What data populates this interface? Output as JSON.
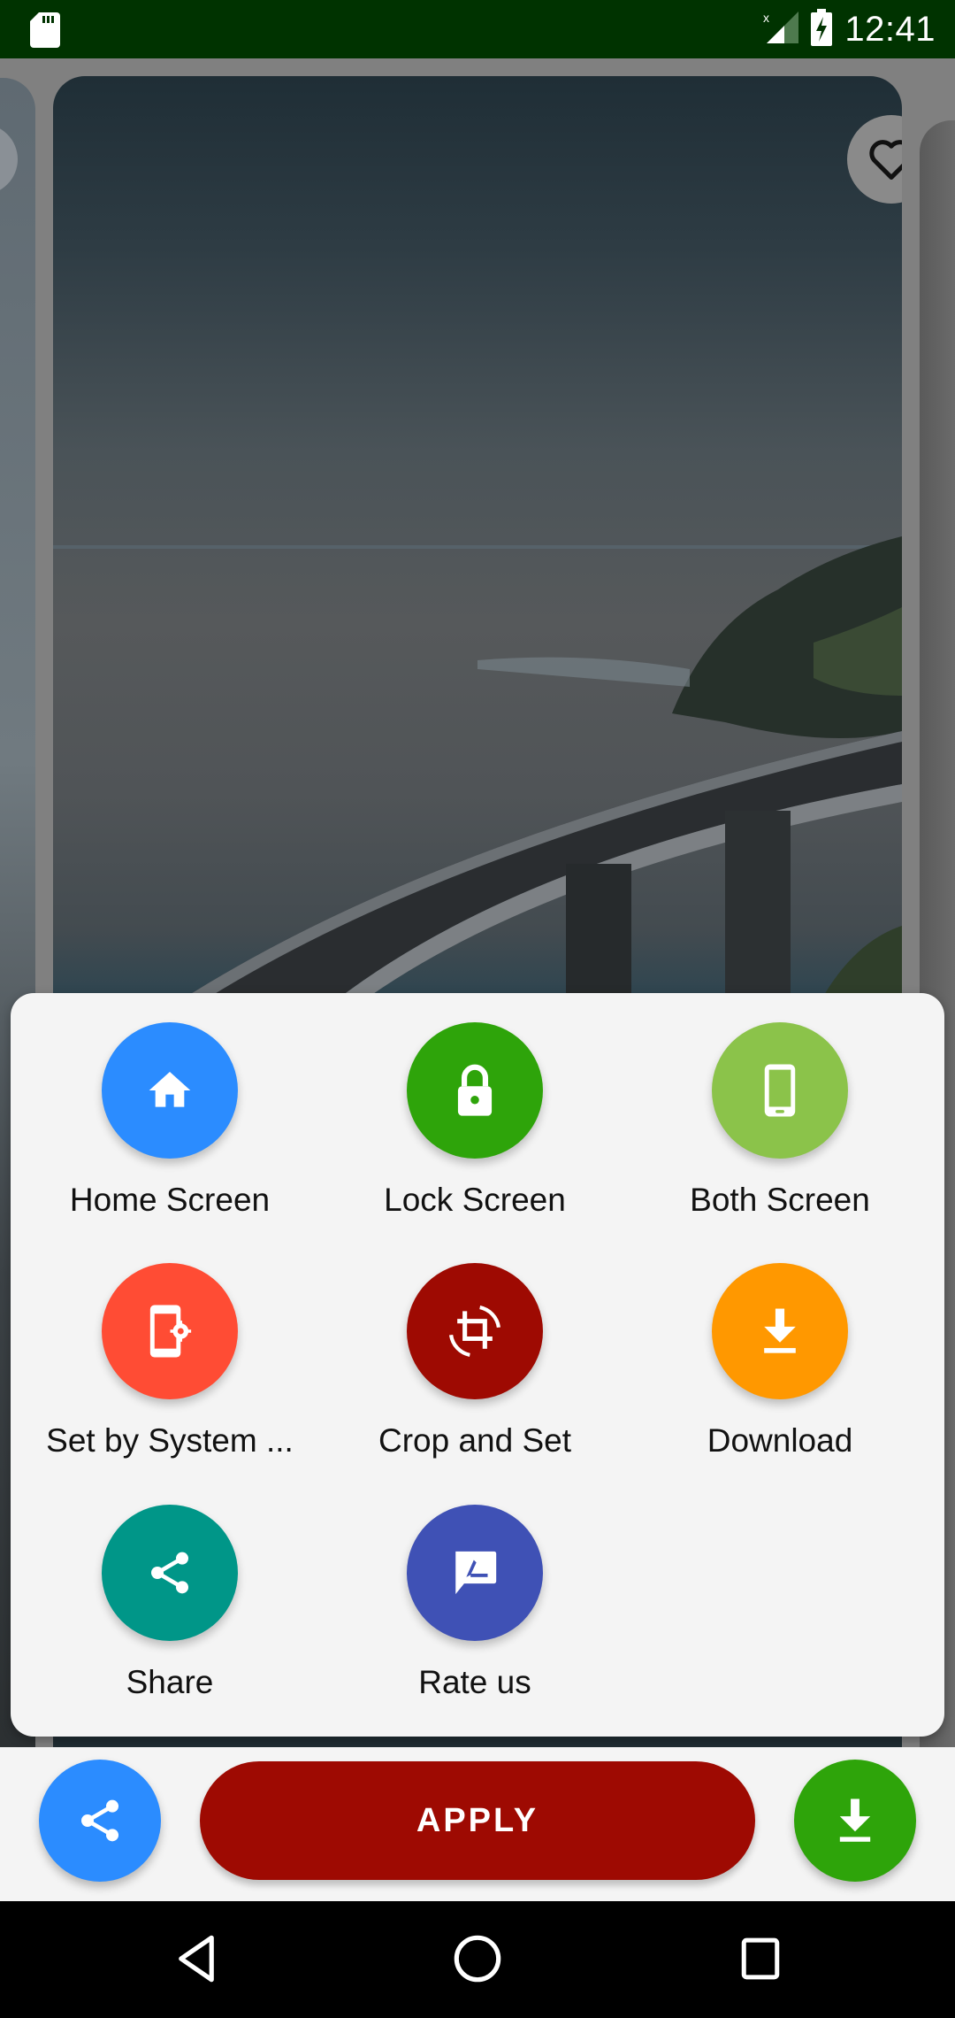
{
  "status_bar": {
    "time": "12:41",
    "icons": [
      "sd-card-icon",
      "signal-no-data-icon",
      "battery-charging-icon"
    ]
  },
  "viewer": {
    "favorite_icon": "heart-outline-icon",
    "wallpaper_description": "Coastal curved bridge over the sea under a cloudy sky"
  },
  "sheet": {
    "options": [
      {
        "label": "Home Screen",
        "icon": "home-icon",
        "color": "#2b8cff"
      },
      {
        "label": "Lock Screen",
        "icon": "lock-icon",
        "color": "#2ea40a"
      },
      {
        "label": "Both Screen",
        "icon": "smartphone-icon",
        "color": "#8bc34a"
      },
      {
        "label": "Set by System ...",
        "icon": "phone-settings-icon",
        "color": "#ff4c34"
      },
      {
        "label": "Crop and Set",
        "icon": "crop-rotate-icon",
        "color": "#9e0a02"
      },
      {
        "label": "Download",
        "icon": "download-icon",
        "color": "#ff9800"
      },
      {
        "label": "Share",
        "icon": "share-icon",
        "color": "#009688"
      },
      {
        "label": "Rate us",
        "icon": "rate-review-icon",
        "color": "#3f51b5"
      }
    ]
  },
  "action_bar": {
    "share_icon": "share-icon",
    "apply_label": "APPLY",
    "download_icon": "download-icon",
    "colors": {
      "share": "#2b8cff",
      "apply": "#9e0a02",
      "download": "#2ea40a"
    }
  },
  "nav_bar": {
    "back": "back-icon",
    "home": "home-circle-icon",
    "recents": "recents-icon"
  }
}
